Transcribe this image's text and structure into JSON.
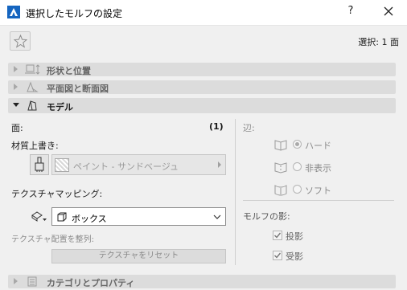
{
  "window": {
    "title": "選択したモルフの設定",
    "help_label": "?",
    "selection_text": "選択: 1 面"
  },
  "sections": {
    "shape": {
      "label": "形状と位置",
      "expanded": false
    },
    "plan": {
      "label": "平面図と断面図",
      "expanded": false
    },
    "model": {
      "label": "モデル",
      "expanded": true
    },
    "category": {
      "label": "カテゴリとプロパティ",
      "expanded": false
    }
  },
  "model": {
    "face_label": "面:",
    "face_count": "(1)",
    "material_override_label": "材質上書き:",
    "material_value": "ペイント - サンドベージュ",
    "texture_mapping_label": "テクスチャマッピング:",
    "texture_mapping_value": "ボックス",
    "texture_align_label": "テクスチャ配置を整列:",
    "texture_reset_label": "テクスチャをリセット"
  },
  "edges": {
    "label": "辺:",
    "options": [
      {
        "label": "ハード",
        "checked": true
      },
      {
        "label": "非表示",
        "checked": false
      },
      {
        "label": "ソフト",
        "checked": false
      }
    ]
  },
  "shadows": {
    "label": "モルフの影:",
    "cast": {
      "label": "投影",
      "checked": true
    },
    "receive": {
      "label": "受影",
      "checked": true
    }
  },
  "colors": {
    "accent": "#1565c0",
    "section_bg": "#dcdcdc",
    "disabled_text": "#8a8a8a"
  },
  "icons": [
    "archicad-app-icon",
    "close-icon",
    "star-icon",
    "shape-position-icon",
    "plan-section-icon",
    "model-icon",
    "category-icon",
    "paint-brush-icon",
    "material-swatch-icon",
    "texture-mapping-icon",
    "box-icon",
    "chevron-down-icon",
    "edge-hard-icon",
    "edge-hidden-icon",
    "edge-soft-icon",
    "checkmark-icon"
  ]
}
